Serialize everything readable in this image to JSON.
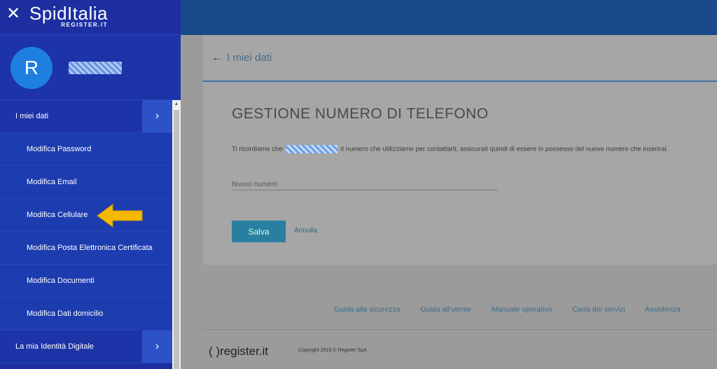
{
  "sidebar": {
    "logo_main": "SpidItalia",
    "logo_sub": "REGISTER.IT",
    "avatar_letter": "R",
    "menu": [
      {
        "label": "I miei dati",
        "level": "top"
      },
      {
        "label": "Modifica Password",
        "level": "sub"
      },
      {
        "label": "Modifica Email",
        "level": "sub"
      },
      {
        "label": "Modifica Cellulare",
        "level": "sub"
      },
      {
        "label": "Modifica Posta Elettronica Certificata",
        "level": "sub"
      },
      {
        "label": "Modifica Documenti",
        "level": "sub"
      },
      {
        "label": "Modifica Dati domicilio",
        "level": "sub"
      },
      {
        "label": "La mia Identità Digitale",
        "level": "top"
      }
    ]
  },
  "main": {
    "back_label": "I miei dati",
    "title": "GESTIONE NUMERO DI TELEFONO",
    "desc_before": "Ti ricordiamo che",
    "desc_after": "il numero che utilizziamo per contattarti, assicurati quindi di essere in possesso del nuovo numero che inserirai.",
    "field_placeholder": "Nuovo numero",
    "save_label": "Salva",
    "cancel_label": "Annulla"
  },
  "footer": {
    "links": [
      "Guida alla sicurezza",
      "Guida all'utente",
      "Manuale operativo",
      "Carta dei servizi",
      "Assistenza"
    ],
    "logo": "( )register.it",
    "copyright": "Copyright 2019 © Register SpA"
  },
  "colors": {
    "sidebar_bg": "#1d2fa0",
    "avatar": "#1e7fe0",
    "save_button": "#2a7fa0",
    "arrow": "#f5b800"
  }
}
